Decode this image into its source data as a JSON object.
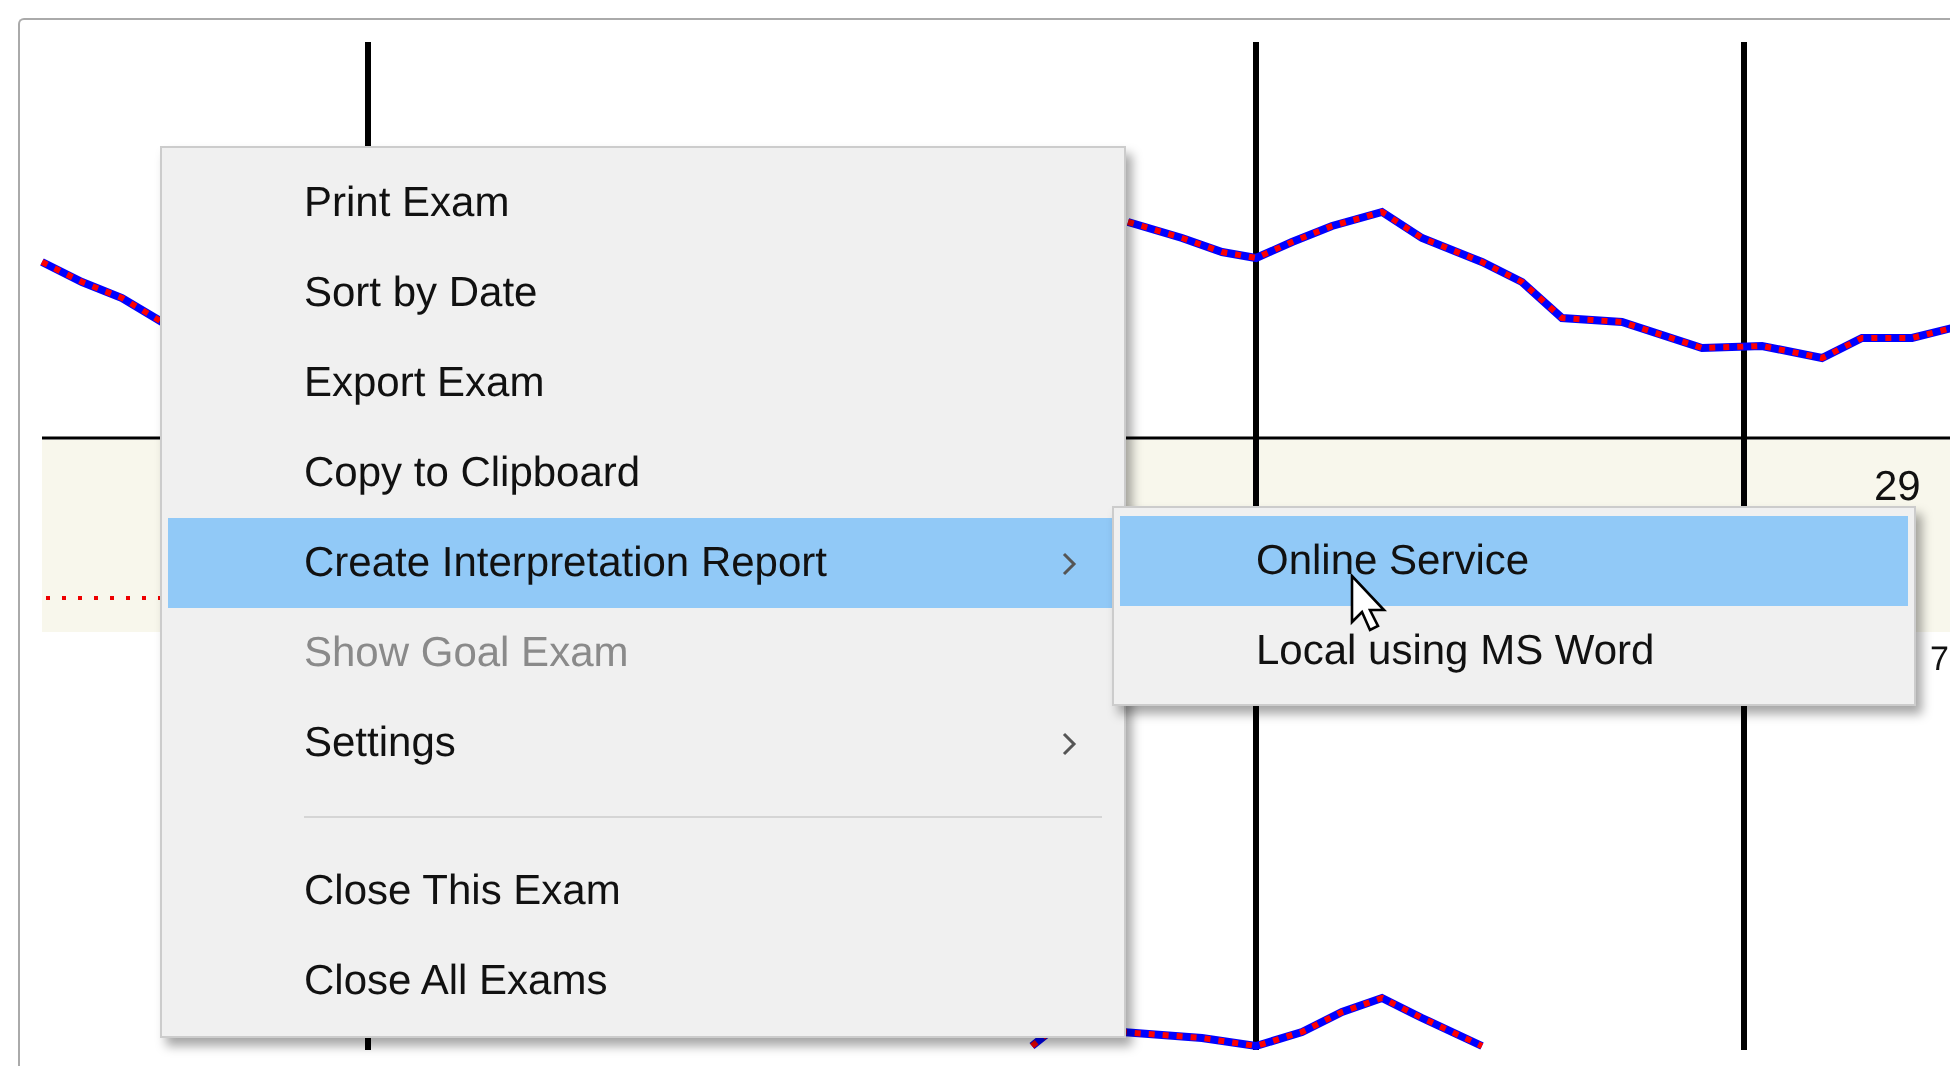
{
  "chart": {
    "labels": [
      {
        "text": "29"
      },
      {
        "text": "7"
      }
    ]
  },
  "context_menu": {
    "items": [
      {
        "kind": "item",
        "label": "Print Exam",
        "disabled": false,
        "selected": false,
        "has_submenu": false
      },
      {
        "kind": "item",
        "label": "Sort by Date",
        "disabled": false,
        "selected": false,
        "has_submenu": false
      },
      {
        "kind": "item",
        "label": "Export Exam",
        "disabled": false,
        "selected": false,
        "has_submenu": false
      },
      {
        "kind": "item",
        "label": "Copy to Clipboard",
        "disabled": false,
        "selected": false,
        "has_submenu": false
      },
      {
        "kind": "item",
        "label": "Create Interpretation Report",
        "disabled": false,
        "selected": true,
        "has_submenu": true
      },
      {
        "kind": "item",
        "label": "Show Goal Exam",
        "disabled": true,
        "selected": false,
        "has_submenu": false
      },
      {
        "kind": "item",
        "label": "Settings",
        "disabled": false,
        "selected": false,
        "has_submenu": true
      },
      {
        "kind": "separator"
      },
      {
        "kind": "item",
        "label": "Close This Exam",
        "disabled": false,
        "selected": false,
        "has_submenu": false
      },
      {
        "kind": "item",
        "label": "Close All Exams",
        "disabled": false,
        "selected": false,
        "has_submenu": false
      }
    ]
  },
  "submenu": {
    "items": [
      {
        "label": "Online Service",
        "selected": true
      },
      {
        "label": "Local using MS Word",
        "selected": false
      }
    ]
  }
}
